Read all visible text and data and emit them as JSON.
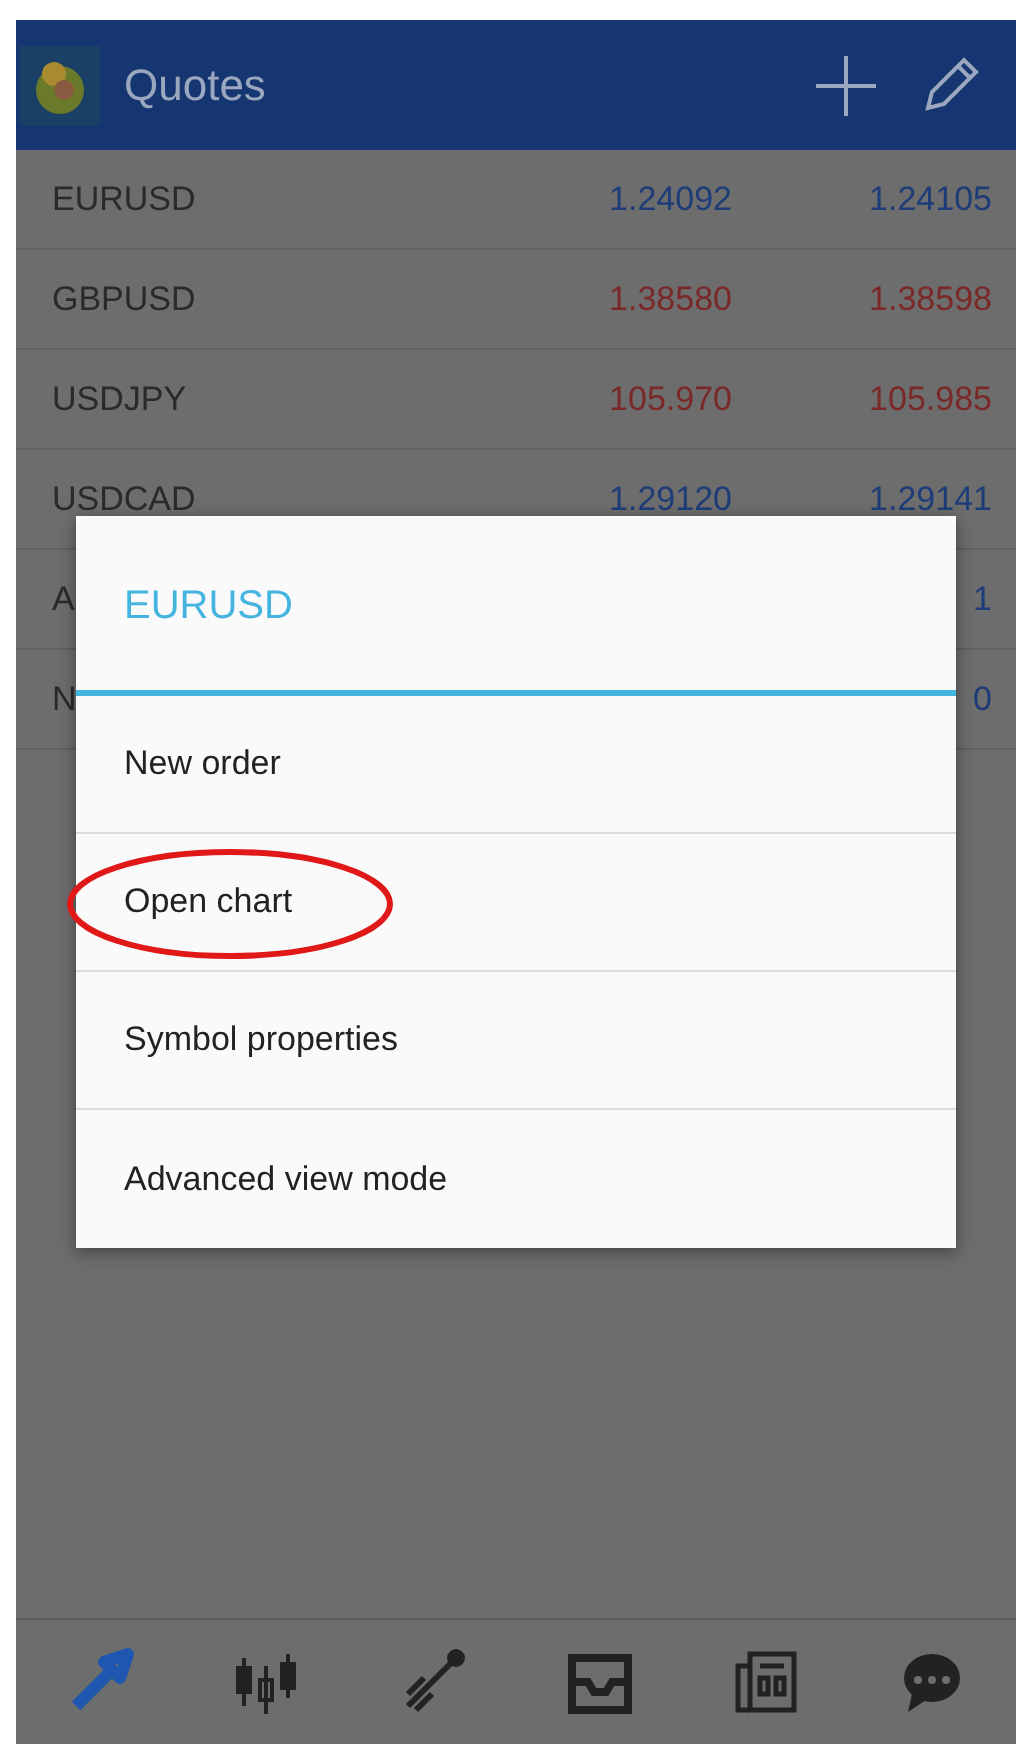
{
  "app_bar": {
    "title": "Quotes"
  },
  "quotes": [
    {
      "symbol": "EURUSD",
      "bid": "1.24092",
      "ask": "1.24105",
      "color": "#1d3c78"
    },
    {
      "symbol": "GBPUSD",
      "bid": "1.38580",
      "ask": "1.38598",
      "color": "#7a2828"
    },
    {
      "symbol": "USDJPY",
      "bid": "105.970",
      "ask": "105.985",
      "color": "#7a2828"
    },
    {
      "symbol": "USDCAD",
      "bid": "1.29120",
      "ask": "1.29141",
      "color": "#1d3c78"
    },
    {
      "symbol": "A",
      "ask": "1",
      "color": "#1d3c78"
    },
    {
      "symbol": "N",
      "ask": "0",
      "color": "#1d3c78"
    }
  ],
  "dialog": {
    "title": "EURUSD",
    "items": [
      {
        "label": "New order",
        "circled": false
      },
      {
        "label": "Open chart",
        "circled": true
      },
      {
        "label": "Symbol properties",
        "circled": false
      },
      {
        "label": "Advanced view mode",
        "circled": false
      }
    ]
  },
  "bottom_nav": [
    {
      "kind": "quotes",
      "selected": true
    },
    {
      "kind": "chart",
      "selected": false
    },
    {
      "kind": "trade",
      "selected": false
    },
    {
      "kind": "inbox",
      "selected": false
    },
    {
      "kind": "news",
      "selected": false
    },
    {
      "kind": "chat",
      "selected": false
    }
  ]
}
